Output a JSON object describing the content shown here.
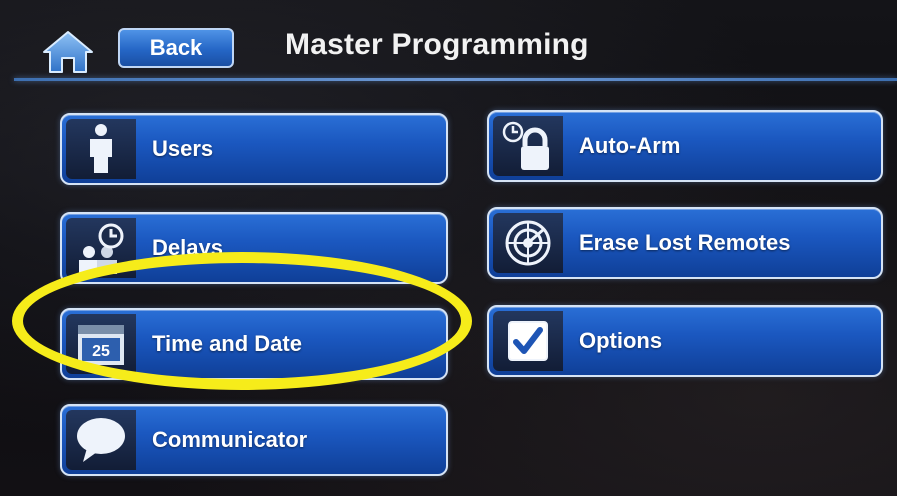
{
  "header": {
    "back_label": "Back",
    "title": "Master Programming",
    "home_icon": "home-icon"
  },
  "left_menu": [
    {
      "label": "Users",
      "icon": "user-icon"
    },
    {
      "label": "Delays",
      "icon": "users-clock-icon"
    },
    {
      "label": "Time and Date",
      "icon": "calendar-icon",
      "icon_text": "25"
    },
    {
      "label": "Communicator",
      "icon": "speech-bubble-icon"
    }
  ],
  "right_menu": [
    {
      "label": "Auto-Arm",
      "icon": "lock-clock-icon"
    },
    {
      "label": "Erase Lost Remotes",
      "icon": "radar-icon"
    },
    {
      "label": "Options",
      "icon": "checkbox-icon"
    }
  ],
  "colors": {
    "accent": "#2a6fd6",
    "tile_border": "#d5e3f5",
    "highlight": "#f6ec1a",
    "background": "#0c0c10"
  }
}
